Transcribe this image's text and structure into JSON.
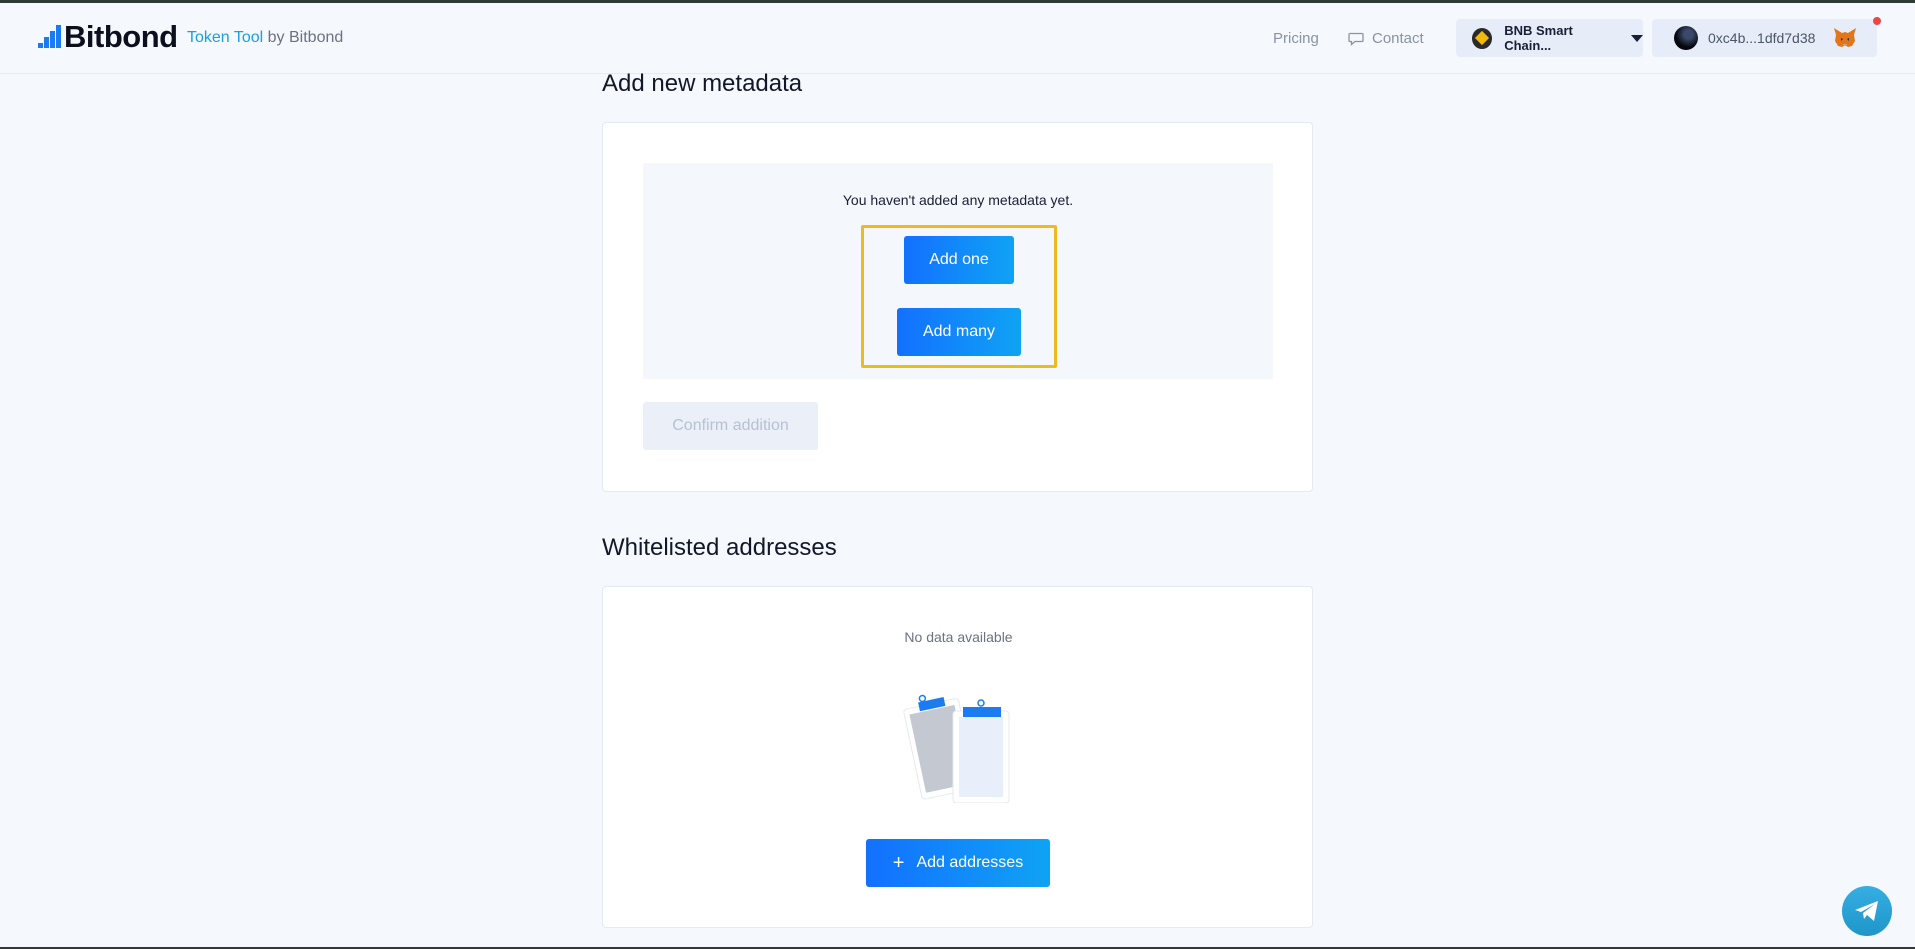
{
  "header": {
    "logo_text": "Bitbond",
    "product_name": "Token Tool",
    "product_by": "by Bitbond",
    "nav": {
      "pricing": "Pricing",
      "contact": "Contact"
    },
    "network": {
      "label": "BNB Smart Chain...",
      "icon": "bnb-icon"
    },
    "wallet": {
      "address": "0xc4b...1dfd7d38",
      "icon": "metamask-fox-icon",
      "has_notification": true
    }
  },
  "metadata_section": {
    "title": "Add new metadata",
    "empty_message": "You haven't added any metadata yet.",
    "add_one_label": "Add one",
    "add_many_label": "Add many",
    "confirm_label": "Confirm addition"
  },
  "whitelist_section": {
    "title": "Whitelisted addresses",
    "empty_message": "No data available",
    "add_button_label": "Add addresses",
    "add_button_icon": "+"
  },
  "colors": {
    "brand_blue": "#1b7cf2",
    "button_gradient_start": "#1370ff",
    "button_gradient_end": "#0fa3f4",
    "highlight": "#f0b91e",
    "telegram": "#37aee2"
  }
}
